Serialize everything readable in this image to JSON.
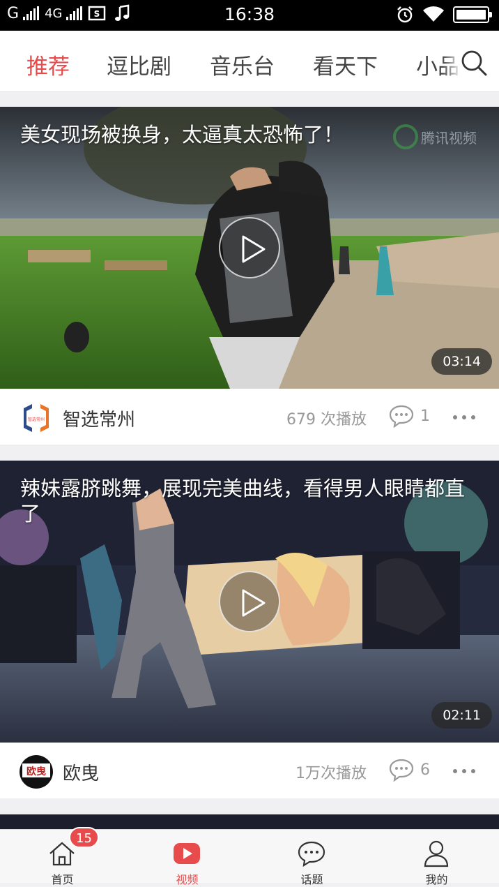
{
  "status_bar": {
    "carrier1": "G",
    "carrier2": "4G",
    "time": "16:38"
  },
  "tabs": [
    "推荐",
    "逗比剧",
    "音乐台",
    "看天下",
    "小品"
  ],
  "active_tab": "推荐",
  "videos": [
    {
      "title": "美女现场被换身，太逼真太恐怖了！",
      "duration": "03:14",
      "author": "智选常州",
      "avatar_text": "智选常州",
      "plays": "679 次播放",
      "comments": "1",
      "watermark": "腾讯视频"
    },
    {
      "title": "辣妹露脐跳舞，展现完美曲线，看得男人眼睛都直了",
      "duration": "02:11",
      "author": "欧曳",
      "avatar_text": "欧曳",
      "plays": "1万次播放",
      "comments": "6"
    }
  ],
  "bottom_nav": [
    {
      "label": "首页",
      "icon": "home-icon",
      "badge": "15"
    },
    {
      "label": "视频",
      "icon": "video-play-icon"
    },
    {
      "label": "话题",
      "icon": "chat-bubble-icon"
    },
    {
      "label": "我的",
      "icon": "user-icon"
    }
  ],
  "colors": {
    "accent": "#e84b4b",
    "status_bar": "#000000",
    "page_bg": "#f0f0f2"
  }
}
